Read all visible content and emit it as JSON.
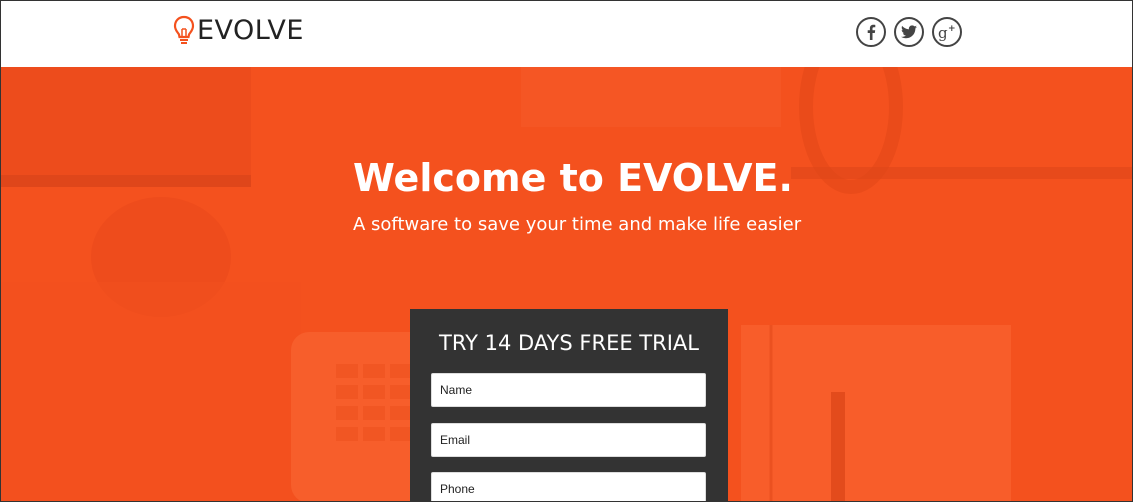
{
  "header": {
    "logo_text": "EVOLVE",
    "social": [
      {
        "icon": "facebook-icon",
        "glyph": "f"
      },
      {
        "icon": "twitter-icon",
        "glyph": ""
      },
      {
        "icon": "google-plus-icon",
        "glyph": "g+"
      }
    ]
  },
  "hero": {
    "title": "Welcome to EVOLVE.",
    "subtitle": "A software to save your time and make life easier"
  },
  "trial_form": {
    "title": "TRY 14 DAYS FREE TRIAL",
    "name_placeholder": "Name",
    "email_placeholder": "Email",
    "phone_placeholder": "Phone"
  },
  "colors": {
    "accent": "#f4511e",
    "form_bg": "#333333",
    "header_bg": "#ffffff",
    "text_dark": "#222222"
  }
}
